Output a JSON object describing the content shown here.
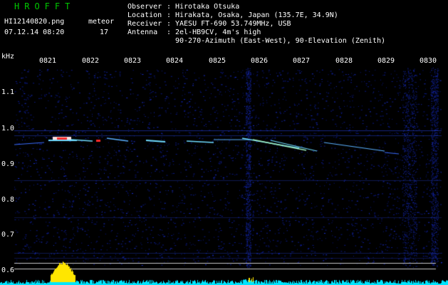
{
  "header": {
    "title": "HROFFT",
    "filename": "HI12140820.png",
    "datetime": "07.12.14 08:20",
    "meteor_label": "meteor",
    "meteor_count": "17"
  },
  "info": [
    {
      "key": "Observer",
      "value": "Hirotaka Otsuka"
    },
    {
      "key": "Location",
      "value": "Hirakata, Osaka, Japan (135.7E, 34.9N)"
    },
    {
      "key": "Receiver",
      "value": "YAESU FT-690 53.749MHz, USB"
    },
    {
      "key": "Antenna",
      "value": "2el-HB9CV, 4m's high"
    },
    {
      "key": "",
      "value": "90-270-Azimuth (East-West), 90-Elevation (Zenith)"
    }
  ],
  "axis": {
    "y_unit": "kHz",
    "y_ticks": [
      "1.1",
      "1.0",
      "0.9",
      "0.8",
      "0.7",
      "0.6"
    ],
    "x_ticks": [
      "0821",
      "0822",
      "0823",
      "0824",
      "0825",
      "0826",
      "0827",
      "0828",
      "0829",
      "0830"
    ]
  },
  "colors": {
    "background": "#000000",
    "title": "#00c800",
    "text": "#ffffff",
    "noise": "#1a2fd0",
    "echo": "#6fdcff",
    "hot": "#ff2a2a",
    "level_low": "#00e5ff",
    "level_high": "#ffe600",
    "ref_line": "#c8c8c8"
  }
}
